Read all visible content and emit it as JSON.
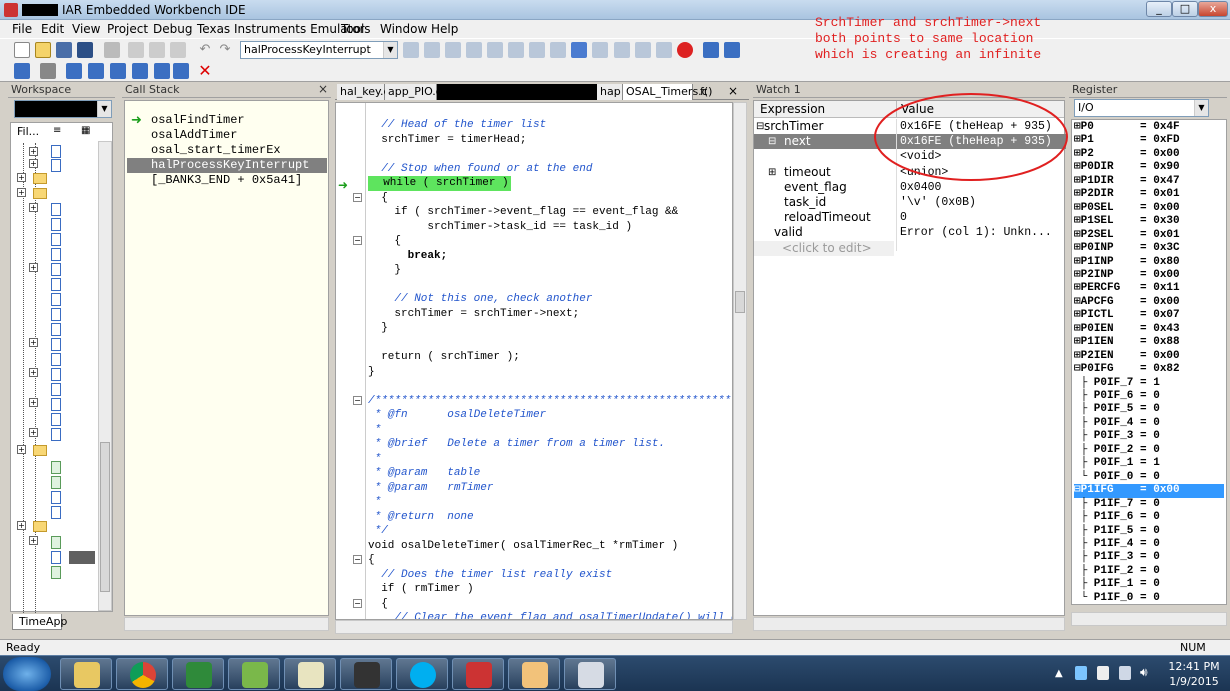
{
  "window": {
    "title": "IAR Embedded Workbench IDE",
    "min_label": "_",
    "max_label": "□",
    "close_label": "x"
  },
  "menu": [
    "File",
    "Edit",
    "View",
    "Project",
    "Debug",
    "Texas Instruments Emulator",
    "Tools",
    "Window",
    "Help"
  ],
  "toolbar": {
    "function_combo": "halProcessKeyInterrupt"
  },
  "workspace": {
    "title": "Workspace",
    "col1": "Fil...",
    "bottom_tab": "TimeApp"
  },
  "callstack": {
    "title": "Call Stack",
    "items": [
      "osalFindTimer",
      "osalAddTimer",
      "osal_start_timerEx",
      "halProcessKeyInterrupt",
      "[_BANK3_END + 0x5a41]"
    ]
  },
  "editor": {
    "tabs": [
      "hal_key.c",
      "app_PIO.c",
      "hap",
      "OSAL_Timers.c",
      "f()"
    ],
    "lines": [
      {
        "t": "  // Head of the timer list",
        "c": "cmt"
      },
      {
        "t": "  srchTimer = timerHead;",
        "c": ""
      },
      {
        "t": "",
        "c": ""
      },
      {
        "t": "  // Stop when found or at the end",
        "c": "cmt"
      },
      {
        "t": "  while ( srchTimer )",
        "c": "hl"
      },
      {
        "t": "  {",
        "c": ""
      },
      {
        "t": "    if ( srchTimer->event_flag == event_flag &&",
        "c": ""
      },
      {
        "t": "         srchTimer->task_id == task_id )",
        "c": ""
      },
      {
        "t": "    {",
        "c": ""
      },
      {
        "t": "      break;",
        "c": "kw"
      },
      {
        "t": "    }",
        "c": ""
      },
      {
        "t": "",
        "c": ""
      },
      {
        "t": "    // Not this one, check another",
        "c": "cmt"
      },
      {
        "t": "    srchTimer = srchTimer->next;",
        "c": ""
      },
      {
        "t": "  }",
        "c": ""
      },
      {
        "t": "",
        "c": ""
      },
      {
        "t": "  return ( srchTimer );",
        "c": ""
      },
      {
        "t": "}",
        "c": ""
      },
      {
        "t": "",
        "c": ""
      },
      {
        "t": "/*********************************************************",
        "c": "cmt"
      },
      {
        "t": " * @fn      osalDeleteTimer",
        "c": "cmt"
      },
      {
        "t": " *",
        "c": "cmt"
      },
      {
        "t": " * @brief   Delete a timer from a timer list.",
        "c": "cmt"
      },
      {
        "t": " *",
        "c": "cmt"
      },
      {
        "t": " * @param   table",
        "c": "cmt"
      },
      {
        "t": " * @param   rmTimer",
        "c": "cmt"
      },
      {
        "t": " *",
        "c": "cmt"
      },
      {
        "t": " * @return  none",
        "c": "cmt"
      },
      {
        "t": " */",
        "c": "cmt"
      },
      {
        "t": "void osalDeleteTimer( osalTimerRec_t *rmTimer )",
        "c": ""
      },
      {
        "t": "{",
        "c": ""
      },
      {
        "t": "  // Does the timer list really exist",
        "c": "cmt"
      },
      {
        "t": "  if ( rmTimer )",
        "c": ""
      },
      {
        "t": "  {",
        "c": ""
      },
      {
        "t": "    // Clear the event flag and osalTimerUpdate() will de",
        "c": "cmt"
      }
    ]
  },
  "watch": {
    "title": "Watch 1",
    "col_expression": "Expression",
    "col_value": "Value",
    "rows": [
      {
        "expr": "srchTimer",
        "value": "0x16FE (theHeap + 935)",
        "selected": false
      },
      {
        "expr": "next",
        "value": "0x16FE (theHeap + 935)",
        "selected": true
      },
      {
        "expr": "",
        "value": "<void>",
        "selected": false
      },
      {
        "expr": "timeout",
        "value": "<union>",
        "selected": false
      },
      {
        "expr": "event_flag",
        "value": "0x0400",
        "selected": false
      },
      {
        "expr": "task_id",
        "value": "'\\v' (0x0B)",
        "selected": false
      },
      {
        "expr": "reloadTimeout",
        "value": "0",
        "selected": false
      },
      {
        "expr": "valid",
        "value": "Error (col 1): Unkn...",
        "selected": false
      },
      {
        "expr": "<click to edit>",
        "value": "",
        "selected": false
      }
    ],
    "annotation": "SrchTimer and srchTimer->next\nboth points to same location\nwhich is creating an infinite"
  },
  "register": {
    "title": "Register",
    "combo": "I/O",
    "rows": [
      "⊞P0       = 0x4F",
      "⊞P1       = 0xFD",
      "⊞P2       = 0x00",
      "⊞P0DIR    = 0x90",
      "⊞P1DIR    = 0x47",
      "⊞P2DIR    = 0x01",
      "⊞P0SEL    = 0x00",
      "⊞P1SEL    = 0x30",
      "⊞P2SEL    = 0x01",
      "⊞P0INP    = 0x3C",
      "⊞P1INP    = 0x80",
      "⊞P2INP    = 0x00",
      "⊞PERCFG   = 0x11",
      "⊞APCFG    = 0x00",
      "⊞PICTL    = 0x07",
      "⊞P0IEN    = 0x43",
      "⊞P1IEN    = 0x88",
      "⊞P2IEN    = 0x00",
      "⊟P0IFG    = 0x82",
      " ├ P0IF_7 = 1",
      " ├ P0IF_6 = 0",
      " ├ P0IF_5 = 0",
      " ├ P0IF_4 = 0",
      " ├ P0IF_3 = 0",
      " ├ P0IF_2 = 0",
      " ├ P0IF_1 = 1",
      " └ P0IF_0 = 0",
      "⊟P1IFG    = 0x00",
      " ├ P1IF_7 = 0",
      " ├ P1IF_6 = 0",
      " ├ P1IF_5 = 0",
      " ├ P1IF_4 = 0",
      " ├ P1IF_3 = 0",
      " ├ P1IF_2 = 0",
      " ├ P1IF_1 = 0",
      " └ P1IF_0 = 0"
    ],
    "selected_index": 27
  },
  "status": {
    "left": "Ready",
    "num": "NUM"
  },
  "taskbar": {
    "time": "12:41 PM",
    "date": "1/9/2015"
  }
}
